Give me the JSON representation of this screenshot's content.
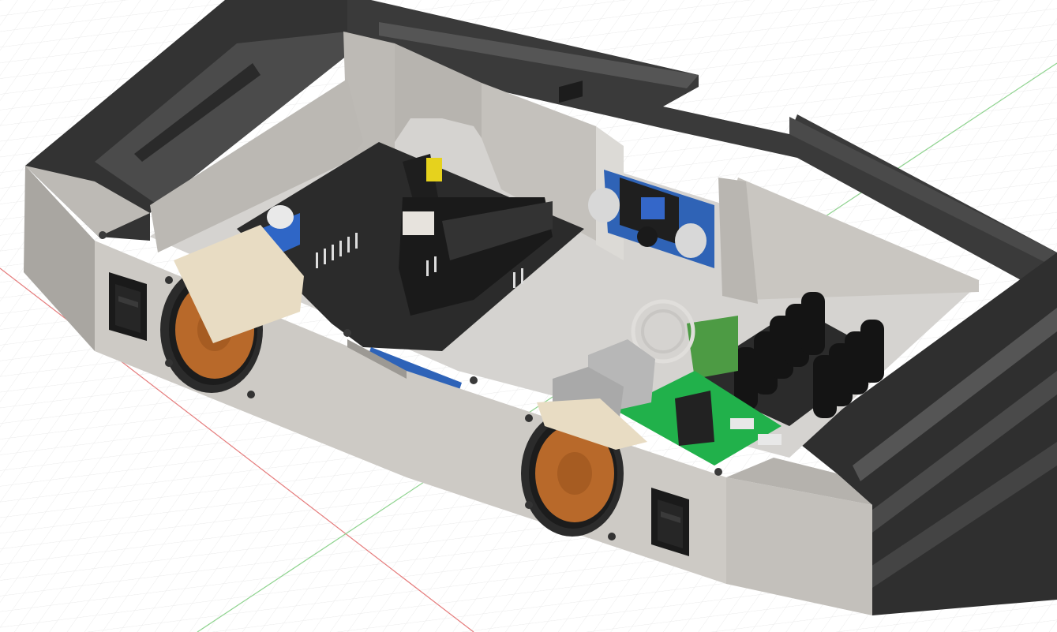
{
  "viewport": {
    "background": "#ffffff",
    "grid_minor_color": "#e6e6e6",
    "grid_major_color": "#d2d2d2",
    "x_axis_color": "#e57b7b",
    "y_axis_color": "#8fd38f"
  },
  "model": {
    "frame_color": "#3a3a3a",
    "panel_color": "#cdcac5",
    "panel_shadow": "#a9a6a1",
    "fan_blade_color": "#b8692a",
    "pcb_green": "#21b14b",
    "pcb_dark": "#2b2b2b",
    "pcb_blue": "#2e63b8",
    "capacitor_color": "#161616",
    "terminal_green": "#4d9b44"
  },
  "icons": {
    "rocker_switch": "rocker-switch-icon",
    "fan": "fan-icon",
    "usb": "usb-port-icon"
  }
}
